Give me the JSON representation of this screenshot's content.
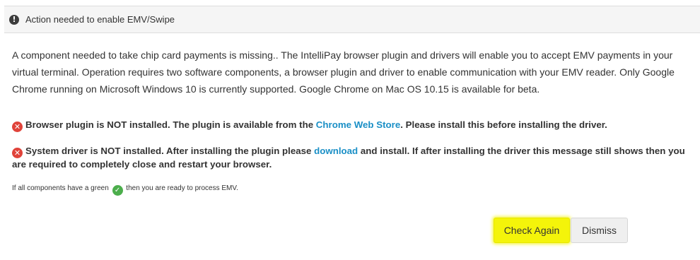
{
  "header": {
    "icon": "alert-icon",
    "title": "Action needed to enable EMV/Swipe"
  },
  "intro": "A component needed to take chip card payments is missing.. The IntelliPay browser plugin and drivers will enable you to accept EMV payments in your virtual terminal. Operation requires two software components, a browser plugin and driver to enable communication with your EMV reader. Only Google Chrome running on Microsoft Windows 10 is currently supported. Google Chrome on Mac OS 10.15 is available for beta.",
  "plugin_status": {
    "icon": "error-x-icon",
    "text_before": "Browser plugin is NOT installed. The plugin is available from the ",
    "link": "Chrome Web Store",
    "text_after": ". Please install this before installing the driver."
  },
  "driver_status": {
    "icon": "error-x-icon",
    "text_before": "System driver is NOT installed. After installing the plugin please ",
    "link": "download",
    "text_after": " and install. If after installing the driver this message still shows then you are required to completely close and restart your browser."
  },
  "note": {
    "text_before": "If all components have a green ",
    "icon": "green-check-icon",
    "text_after": " then you are ready to process EMV."
  },
  "buttons": {
    "check_again": "Check Again",
    "dismiss": "Dismiss"
  },
  "colors": {
    "link": "#1a8fc6",
    "error": "#e0433a",
    "success": "#4cae4c",
    "highlight": "#f4f40a"
  }
}
